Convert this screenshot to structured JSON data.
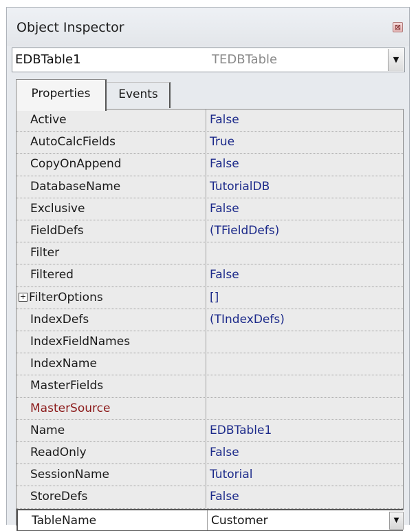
{
  "window": {
    "title": "Object Inspector",
    "close_glyph": "⊠"
  },
  "object_selector": {
    "name": "EDBTable1",
    "type": "TEDBTable",
    "dropdown_glyph": "▼"
  },
  "tabs": [
    {
      "label": "Properties",
      "active": true
    },
    {
      "label": "Events",
      "active": false
    }
  ],
  "properties": [
    {
      "name": "Active",
      "value": "False"
    },
    {
      "name": "AutoCalcFields",
      "value": "True"
    },
    {
      "name": "CopyOnAppend",
      "value": "False"
    },
    {
      "name": "DatabaseName",
      "value": "TutorialDB"
    },
    {
      "name": "Exclusive",
      "value": "False"
    },
    {
      "name": "FieldDefs",
      "value": "(TFieldDefs)"
    },
    {
      "name": "Filter",
      "value": ""
    },
    {
      "name": "Filtered",
      "value": "False"
    },
    {
      "name": "FilterOptions",
      "value": "[]",
      "expandable": true,
      "expander": "+"
    },
    {
      "name": "IndexDefs",
      "value": "(TIndexDefs)"
    },
    {
      "name": "IndexFieldNames",
      "value": ""
    },
    {
      "name": "IndexName",
      "value": ""
    },
    {
      "name": "MasterFields",
      "value": ""
    },
    {
      "name": "MasterSource",
      "value": "",
      "reference": true
    },
    {
      "name": "Name",
      "value": "EDBTable1"
    },
    {
      "name": "ReadOnly",
      "value": "False"
    },
    {
      "name": "SessionName",
      "value": "Tutorial"
    },
    {
      "name": "StoreDefs",
      "value": "False"
    },
    {
      "name": "TableName",
      "value": "Customer",
      "selected": true
    }
  ],
  "colors": {
    "value_text": "#1c2a8a",
    "reference_property": "#8b1a1a",
    "row_background": "#ebebeb"
  }
}
